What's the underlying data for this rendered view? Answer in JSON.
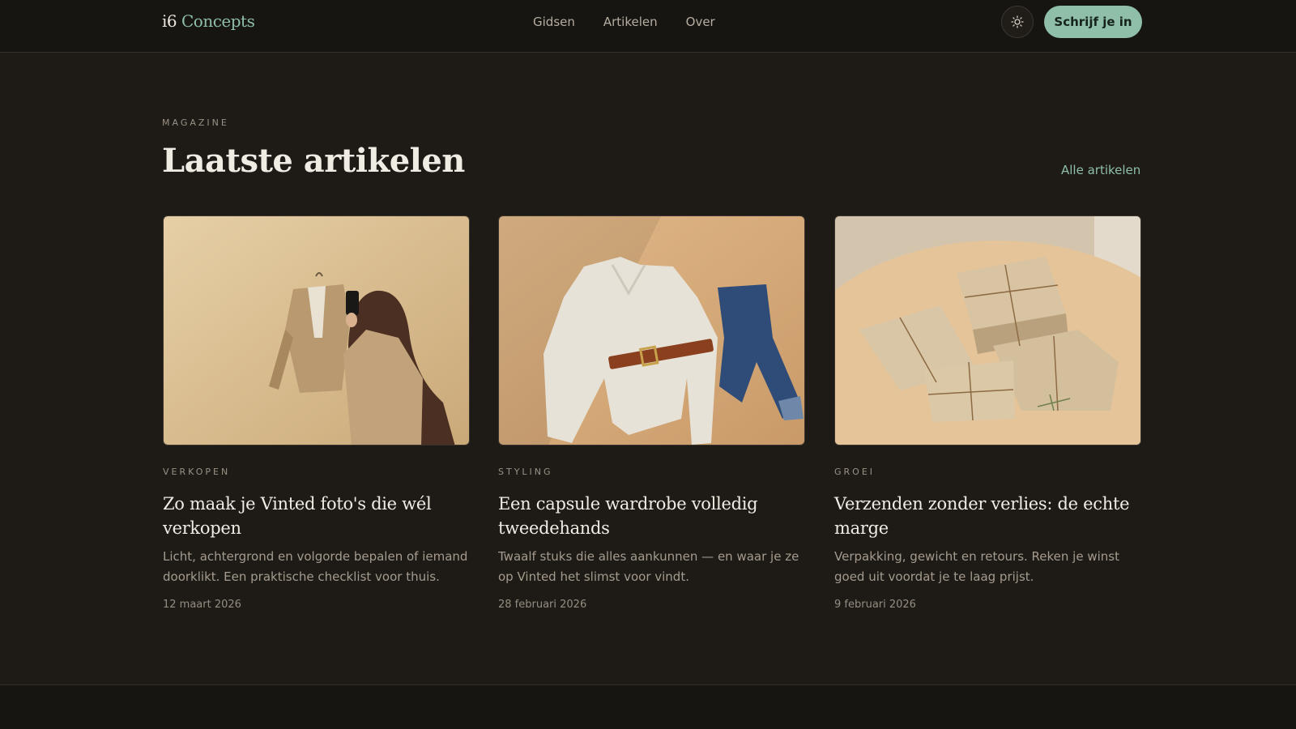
{
  "header": {
    "logo_part1": "i6",
    "logo_part2": " Concepts",
    "nav": [
      "Gidsen",
      "Artikelen",
      "Over"
    ],
    "theme_icon": "sun-icon",
    "cta_label": "Schrijf je in"
  },
  "section": {
    "eyebrow": "MAGAZINE",
    "title": "Laatste artikelen",
    "all_link": "Alle artikelen"
  },
  "articles": [
    {
      "category": "VERKOPEN",
      "title": "Zo maak je Vinted foto's die wél verkopen",
      "excerpt": "Licht, achtergrond en volgorde bepalen of iemand doorklikt. Een praktische checklist voor thuis.",
      "date": "12 maart 2026"
    },
    {
      "category": "STYLING",
      "title": "Een capsule wardrobe volledig tweedehands",
      "excerpt": "Twaalf stuks die alles aankunnen — en waar je ze op Vinted het slimst voor vindt.",
      "date": "28 februari 2026"
    },
    {
      "category": "GROEI",
      "title": "Verzenden zonder verlies: de echte marge",
      "excerpt": "Verpakking, gewicht en retours. Reken je winst goed uit voordat je te laag prijst.",
      "date": "9 februari 2026"
    }
  ],
  "colors": {
    "background": "#1e1b17",
    "header": "#171512",
    "accent": "#8fbfa8"
  }
}
